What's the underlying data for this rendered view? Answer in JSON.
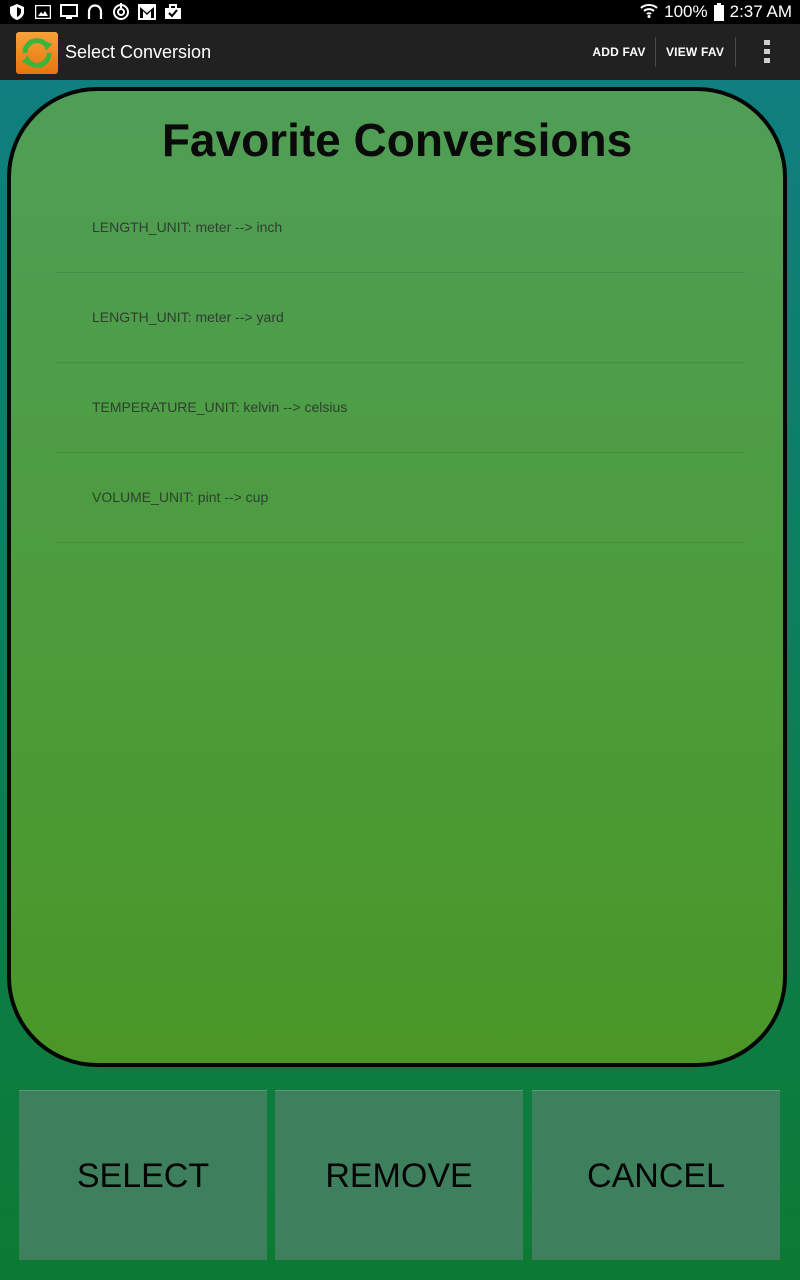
{
  "status_bar": {
    "battery": "100%",
    "time": "2:37 AM",
    "left_icons": [
      "shield-icon",
      "image-icon",
      "cast-icon",
      "headset-icon",
      "sync-icon",
      "gmail-icon",
      "briefcase-icon"
    ],
    "right_icons": [
      "wifi-icon",
      "battery-icon"
    ]
  },
  "action_bar": {
    "title": "Select Conversion",
    "app_icon": "refresh-arrows-icon",
    "add_fav": "ADD FAV",
    "view_fav": "VIEW FAV",
    "overflow_icon": "more-vertical-icon"
  },
  "card": {
    "title": "Favorite Conversions",
    "items": [
      {
        "label": "LENGTH_UNIT: meter --> inch"
      },
      {
        "label": "LENGTH_UNIT: meter --> yard"
      },
      {
        "label": "TEMPERATURE_UNIT: kelvin --> celsius"
      },
      {
        "label": "VOLUME_UNIT: pint --> cup"
      }
    ]
  },
  "buttons": {
    "select": "SELECT",
    "remove": "REMOVE",
    "cancel": "CANCEL"
  },
  "colors": {
    "action_bar": "#212121",
    "card_fill": "#4c9c3c",
    "card_border": "#050505",
    "button_fill": "#3e7f5e",
    "app_icon_orange": "#f08a1c",
    "app_icon_green": "#3cb43c"
  }
}
